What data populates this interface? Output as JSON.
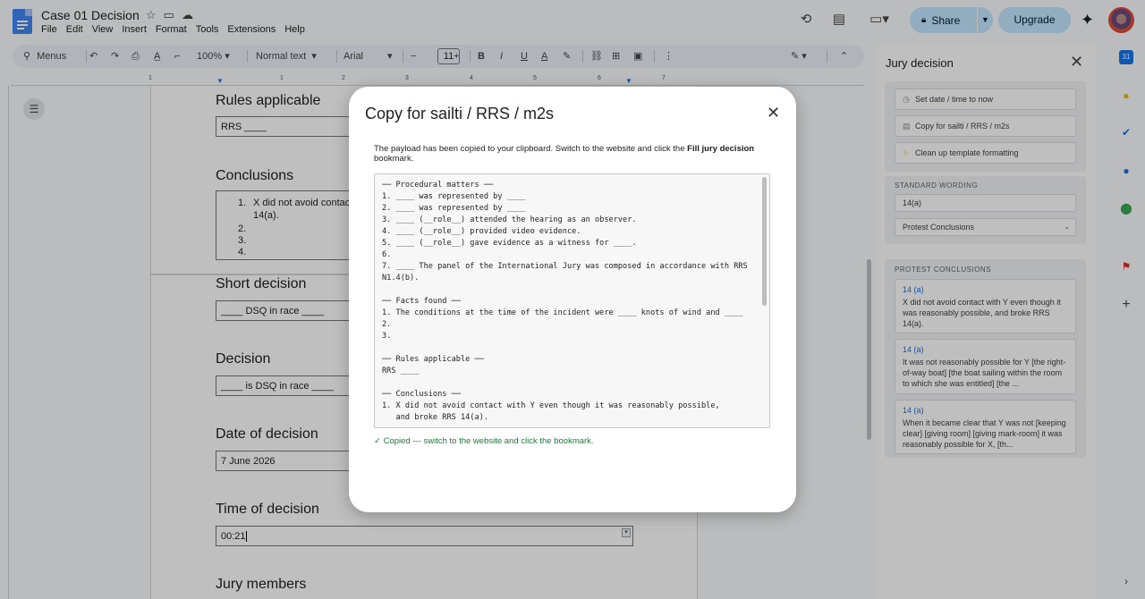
{
  "app": {
    "doc_title": "Case 01 Decision",
    "menu": [
      "File",
      "Edit",
      "View",
      "Insert",
      "Format",
      "Tools",
      "Extensions",
      "Help"
    ],
    "share_label": "Share",
    "upgrade_label": "Upgrade"
  },
  "toolbar": {
    "menus_label": "Menus",
    "zoom": "100%",
    "style": "Normal text",
    "font": "Arial",
    "font_size": "11"
  },
  "ruler_numbers": [
    "1",
    "1",
    "2",
    "3",
    "4",
    "5",
    "6",
    "7"
  ],
  "document": {
    "rules_heading": "Rules applicable",
    "rules_value": "RRS ____",
    "conclusions_heading": "Conclusions",
    "conclusions_items": [
      "X did not avoid contac",
      "14(a).",
      "",
      "",
      ""
    ],
    "conclusion_numbers": [
      "1.",
      "2.",
      "3.",
      "4."
    ],
    "short_decision_heading": "Short decision",
    "short_decision_value": "____ DSQ in race ____",
    "decision_heading": "Decision",
    "decision_value": "____ is DSQ in race ____",
    "date_heading": "Date of decision",
    "date_value": "7 June 2026",
    "time_heading": "Time of decision",
    "time_value": "00:21",
    "jury_heading": "Jury members"
  },
  "panel": {
    "title": "Jury decision",
    "buttons": [
      "Set date / time to now",
      "Copy for sailti / RRS / m2s",
      "Clean up template formatting"
    ],
    "standard_wording_label": "STANDARD WORDING",
    "standard_wording_value": "14(a)",
    "select_value": "Protest Conclusions",
    "protest_conclusions_label": "PROTEST CONCLUSIONS",
    "cards": [
      {
        "ref": "14 (a)",
        "text": "X did not avoid contact with Y even though it was reasonably possible, and broke RRS 14(a)."
      },
      {
        "ref": "14 (a)",
        "text": "It was not reasonably possible for Y [the right-of-way boat] [the boat sailing within the room to which she was entitled] [the ..."
      },
      {
        "ref": "14 (a)",
        "text": "When it became clear that Y was not [keeping clear] [giving room] [giving mark-room] it was reasonably possible for X, [th..."
      }
    ]
  },
  "modal": {
    "title": "Copy for sailti / RRS / m2s",
    "desc_prefix": "The payload has been copied to your clipboard. Switch to the website and click the ",
    "desc_bold": "Fill jury decision",
    "desc_suffix": " bookmark.",
    "payload": "── Procedural matters ──\n1. ____ was represented by ____\n2. ____ was represented by ____\n3. ____ (__role__) attended the hearing as an observer.\n4. ____ (__role__) provided video evidence.\n5. ____ (__role__) gave evidence as a witness for ____.\n6.\n7. ____ The panel of the International Jury was composed in accordance with RRS N1.4(b).\n\n── Facts found ──\n1. The conditions at the time of the incident were ____ knots of wind and ____\n2.\n3.\n\n── Rules applicable ──\nRRS ____\n\n── Conclusions ──\n1. X did not avoid contact with Y even though it was reasonably possible,\n   and broke RRS 14(a).",
    "status": "✓ Copied — switch to the website and click the bookmark."
  },
  "colors": {
    "accent": "#1a73e8",
    "share_bg": "#c2e7ff",
    "success": "#188038"
  }
}
